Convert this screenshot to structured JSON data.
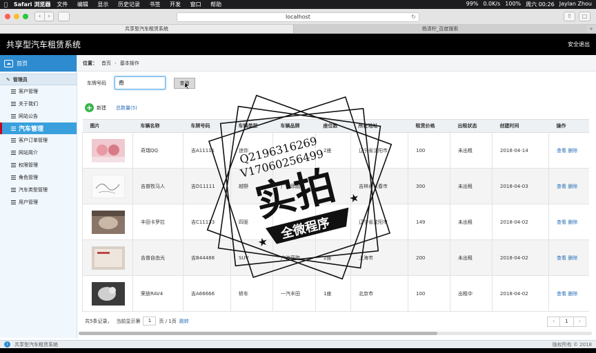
{
  "macos": {
    "app": "Safari 浏览器",
    "menus": [
      "文件",
      "编辑",
      "显示",
      "历史记录",
      "书签",
      "开发",
      "窗口",
      "帮助"
    ],
    "status": [
      "99%",
      "0.0K/s",
      "100%",
      "周六 00:26",
      "Jaylan Zhou"
    ]
  },
  "browser": {
    "url": "localhost",
    "tabs": [
      "共享型汽车租赁系统",
      "杨清柠_百度搜索"
    ]
  },
  "header": {
    "title": "共享型汽车租赁系统",
    "logout": "安全退出"
  },
  "sidebar": {
    "home": "首页",
    "admin": "管理员",
    "items": [
      "客户管理",
      "关于我们",
      "网站公告",
      "汽车管理",
      "客户订单管理",
      "网站简介",
      "权限管理",
      "角色管理",
      "汽车类型管理",
      "用户管理"
    ]
  },
  "breadcrumb": {
    "label": "位置：",
    "home": "首页",
    "current": "基本操作"
  },
  "search": {
    "label": "车牌号码",
    "value": "奇",
    "button": "查询"
  },
  "actions": {
    "new": "新建",
    "count": "总数量(5)"
  },
  "table": {
    "headers": [
      "图片",
      "车辆名称",
      "车牌号码",
      "车辆类型",
      "车辆品牌",
      "座位数",
      "所在地址",
      "租赁价格",
      "出租状态",
      "创建时间",
      "操作"
    ],
    "rows": [
      {
        "name": "奇瑞QQ",
        "plate": "吉A11111",
        "type": "迷你",
        "brand": "",
        "seats": "2座",
        "addr": "辽宁省沈阳市",
        "price": "100",
        "status": "未出租",
        "date": "2018-04-14"
      },
      {
        "name": "吉普牧马人",
        "plate": "吉D11111",
        "type": "越野",
        "brand": "广汽菲跑",
        "seats": "",
        "addr": "吉林省长春市",
        "price": "300",
        "status": "未出租",
        "date": "2018-04-03"
      },
      {
        "name": "丰田卡罗拉",
        "plate": "吉C11133",
        "type": "四驱",
        "brand": "",
        "seats": "",
        "addr": "辽宁省沈阳市",
        "price": "149",
        "status": "未出租",
        "date": "2018-04-02"
      },
      {
        "name": "吉普自由光",
        "plate": "吉B44488",
        "type": "SUV",
        "brand": "广汽菲跑",
        "seats": "2座",
        "addr": "上海市",
        "price": "200",
        "status": "未出租",
        "date": "2018-04-02"
      },
      {
        "name": "荣放RAV4",
        "plate": "吉A66666",
        "type": "轿车",
        "brand": "一汽丰田",
        "seats": "1座",
        "addr": "北京市",
        "price": "100",
        "status": "出租中",
        "date": "2018-04-02"
      }
    ],
    "view": "查看",
    "del": "删除"
  },
  "paging": {
    "records": "共5条记录，",
    "current": "当前显示第",
    "page": "1",
    "total": "页 / 1页",
    "jump": "跳转",
    "pager_page": "1"
  },
  "status_footer": {
    "left": "共享型汽车租赁系统",
    "right": "版权所有 © 2018"
  },
  "watermark": {
    "line1": "Q2196316269",
    "line2": "V17060256499",
    "big": "实拍",
    "ribbon": "全微程序"
  }
}
